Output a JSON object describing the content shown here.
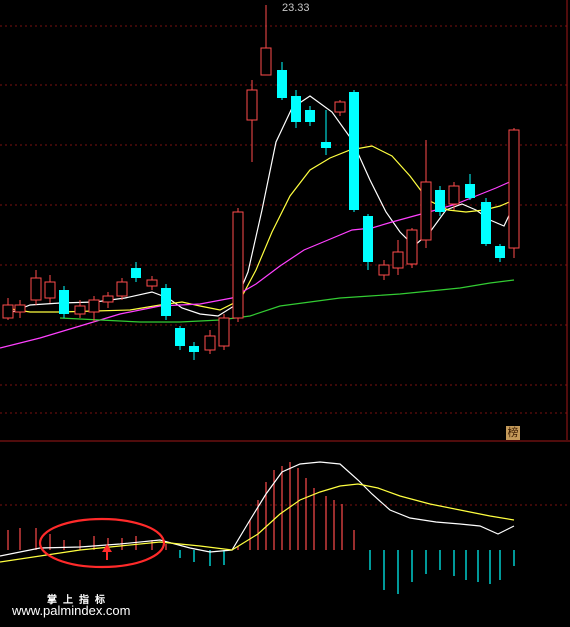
{
  "chart_data": [
    {
      "type": "candlestick",
      "name": "price",
      "peak_label": "23.33",
      "moving_averages": [
        "white",
        "yellow",
        "magenta",
        "green"
      ],
      "colors": {
        "up": "#ff4b4b",
        "down": "#00ffff",
        "ma_fast": "#ffffff",
        "ma_mid": "#ffff40",
        "ma_slow": "#ff40ff",
        "ma_long": "#33cc33",
        "grid": "#7a1010"
      }
    },
    {
      "type": "bar",
      "name": "indicator",
      "lines": [
        "white",
        "yellow"
      ],
      "highlight": "red ellipse with up arrow",
      "colors": {
        "pos": "#ff4b4b",
        "neg": "#00ffff"
      }
    }
  ],
  "badge_text": "榜",
  "watermark": {
    "chinese": "掌上指标",
    "url": "www.palmindex.com"
  }
}
